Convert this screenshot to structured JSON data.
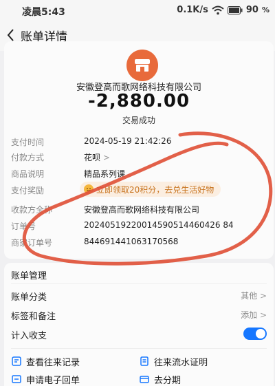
{
  "status_bar": {
    "time": "凌晨5:43",
    "network_speed": "0.1K/s",
    "battery": "90"
  },
  "nav": {
    "title": "账单详情"
  },
  "transaction": {
    "merchant": "安徽登高而歌网络科技有限公司",
    "amount": "-2,880.00",
    "status": "交易成功",
    "accent_color": "#e86a3b",
    "rows": [
      {
        "label": "支付时间",
        "value": "2024-05-19 21:42:26"
      },
      {
        "label": "付款方式",
        "value": "花呗"
      },
      {
        "label": "商品说明",
        "value": "精品系列课"
      },
      {
        "label": "支付奖励",
        "value": "立即领取20积分，去兑生活好物"
      },
      {
        "label": "收款方全称",
        "value": "安徽登高而歌网络科技有限公司"
      },
      {
        "label": "订单号",
        "value": "20240519220014590514460426 84"
      },
      {
        "label": "商家订单号",
        "value": "844691441063170568"
      }
    ]
  },
  "management": {
    "title": "账单管理",
    "category": {
      "label": "账单分类",
      "value": "其他"
    },
    "tags": {
      "label": "标签和备注",
      "value": "添加"
    },
    "include": {
      "label": "计入收支",
      "toggle_on": true,
      "toggle_color": "#1677ff"
    },
    "actions": {
      "history": "查看往来记录",
      "proof": "往来流水证明",
      "receipt": "申请电子回单",
      "installment": "去分期"
    }
  },
  "annotation_color": "#e0533a"
}
